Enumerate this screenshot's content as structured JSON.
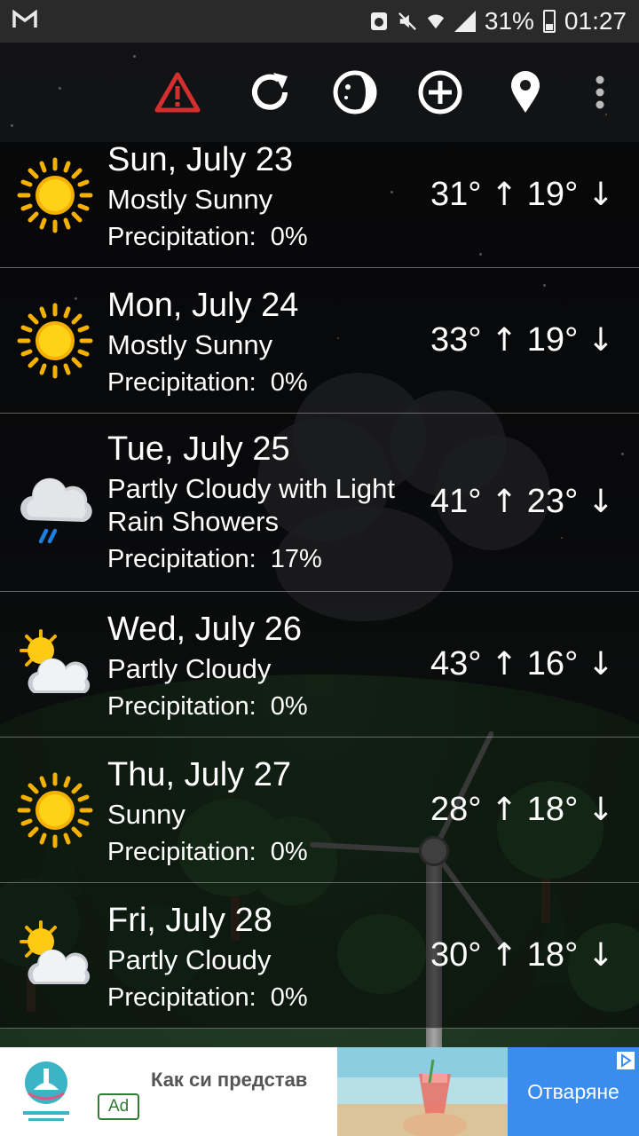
{
  "status_bar": {
    "left_icon": "gmail-icon",
    "battery_percent": "31%",
    "time": "01:27",
    "icons": [
      "recycle-icon",
      "mute-icon",
      "wifi-icon",
      "signal-icon",
      "battery-icon"
    ]
  },
  "toolbar": {
    "icons": [
      "warning-icon",
      "refresh-icon",
      "moon-phase-icon",
      "add-location-icon",
      "location-pin-icon",
      "overflow-menu-icon"
    ],
    "warning_color": "#d32f2f"
  },
  "forecast": [
    {
      "day": "Sun, July 23",
      "condition": "Mostly Sunny",
      "precip_label": "Precipitation:",
      "precip_value": "0%",
      "high": "31°",
      "low": "19°",
      "icon": "sun-icon"
    },
    {
      "day": "Mon, July 24",
      "condition": "Mostly Sunny",
      "precip_label": "Precipitation:",
      "precip_value": "0%",
      "high": "33°",
      "low": "19°",
      "icon": "sun-icon"
    },
    {
      "day": "Tue, July 25",
      "condition_line1": "Partly Cloudy with Light",
      "condition_line2": "Rain Showers",
      "precip_label": "Precipitation:",
      "precip_value": "17%",
      "high": "41°",
      "low": "23°",
      "icon": "rain-cloud-icon"
    },
    {
      "day": "Wed, July 26",
      "condition": "Partly Cloudy",
      "precip_label": "Precipitation:",
      "precip_value": "0%",
      "high": "43°",
      "low": "16°",
      "icon": "partly-cloudy-icon"
    },
    {
      "day": "Thu, July 27",
      "condition": "Sunny",
      "precip_label": "Precipitation:",
      "precip_value": "0%",
      "high": "28°",
      "low": "18°",
      "icon": "sun-icon"
    },
    {
      "day": "Fri, July 28",
      "condition": "Partly Cloudy",
      "precip_label": "Precipitation:",
      "precip_value": "0%",
      "high": "30°",
      "low": "18°",
      "icon": "partly-cloudy-icon"
    }
  ],
  "arrows": {
    "up": "↑",
    "down": "↓"
  },
  "ad": {
    "title": "Как си представ",
    "badge": "Ad",
    "cta": "Отваряне",
    "cta_color": "#3b8ded"
  }
}
